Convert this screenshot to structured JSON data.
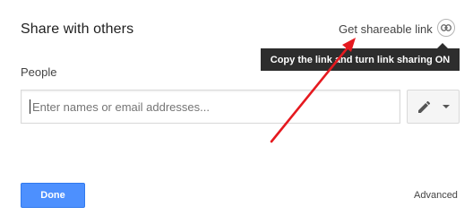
{
  "dialog": {
    "title": "Share with others"
  },
  "share_link": {
    "label": "Get shareable link",
    "icon": "link-icon"
  },
  "tooltip": {
    "text": "Copy the link and turn link sharing ON"
  },
  "people": {
    "label": "People",
    "input_value": "",
    "placeholder": "Enter names or email addresses..."
  },
  "permission_button": {
    "icon": "pencil-icon",
    "dropdown_icon": "caret-down-icon"
  },
  "footer": {
    "done_label": "Done",
    "advanced_label": "Advanced"
  },
  "colors": {
    "primary_button": "#4d90fe",
    "tooltip_bg": "#2d2d2d",
    "annotation_arrow": "#e5191f"
  }
}
